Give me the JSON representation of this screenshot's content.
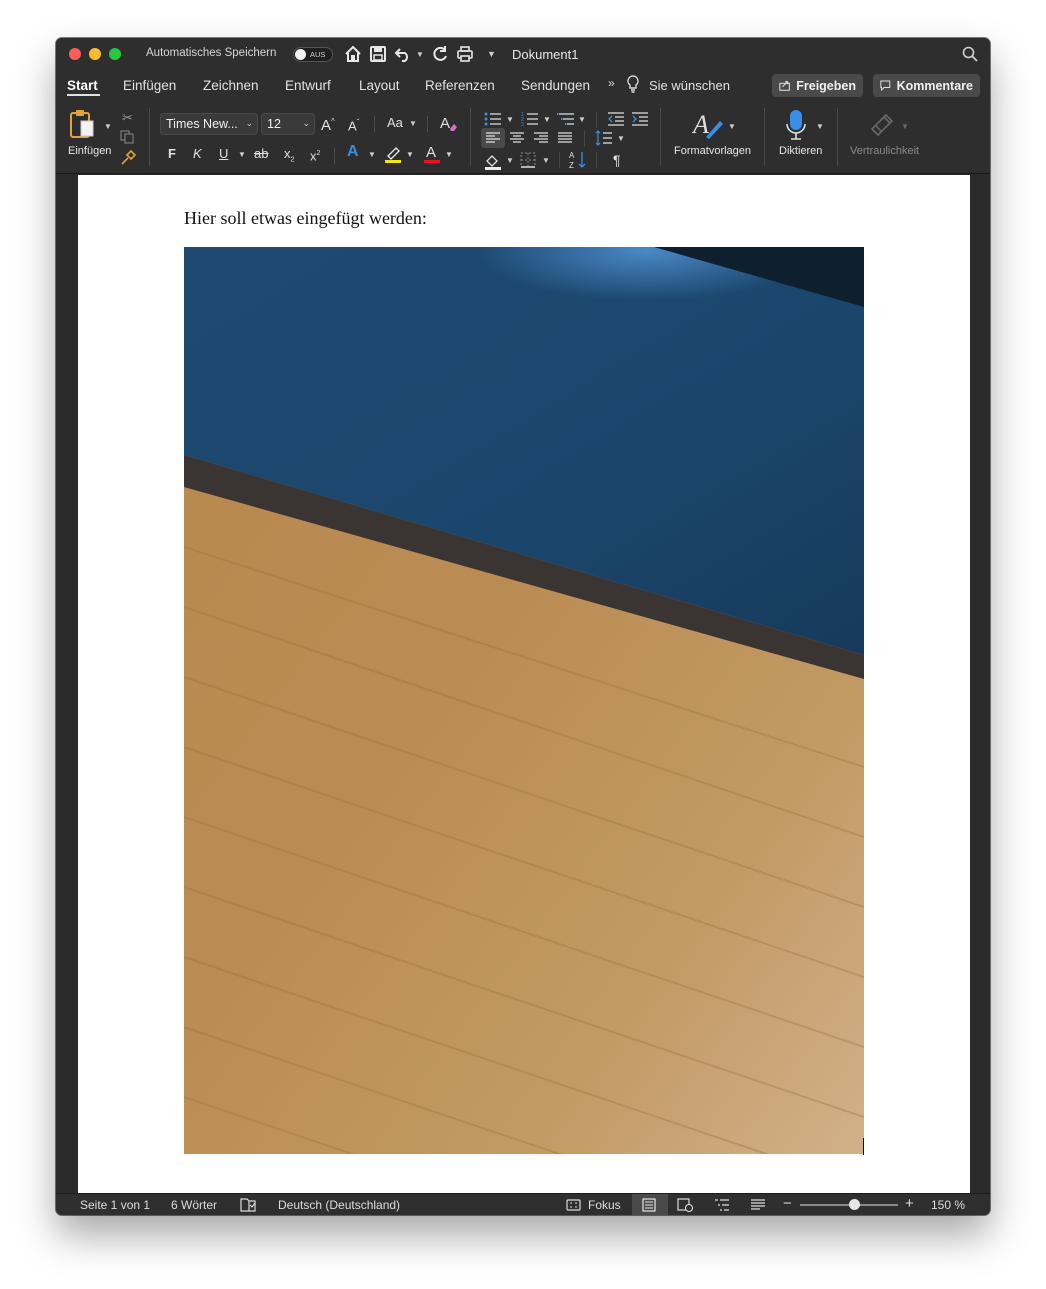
{
  "titlebar": {
    "autosave_label": "Automatisches Speichern",
    "autosave_state": "AUS",
    "document_title": "Dokument1"
  },
  "tabs": [
    {
      "label": "Start",
      "active": true
    },
    {
      "label": "Einfügen"
    },
    {
      "label": "Zeichnen"
    },
    {
      "label": "Entwurf"
    },
    {
      "label": "Layout"
    },
    {
      "label": "Referenzen"
    },
    {
      "label": "Sendungen"
    }
  ],
  "tell_me": "Sie wünschen",
  "share_button": "Freigeben",
  "comments_button": "Kommentare",
  "ribbon": {
    "paste_label": "Einfügen",
    "font_name": "Times New...",
    "font_size": "12",
    "case_label": "Aa",
    "bold": "F",
    "italic": "K",
    "underline": "U",
    "strike": "ab",
    "styles_label": "Formatvorlagen",
    "dictate_label": "Diktieren",
    "sensitivity_label": "Vertraulichkeit"
  },
  "document": {
    "text": "Hier soll etwas eingefügt werden:"
  },
  "statusbar": {
    "page_info": "Seite 1 von 1",
    "word_count": "6 Wörter",
    "language": "Deutsch (Deutschland)",
    "focus_label": "Fokus",
    "zoom": "150 %"
  },
  "colors": {
    "accent_blue": "#3a8ee6",
    "highlight_yellow": "#f5e60a",
    "font_color_red": "#e81123",
    "table_blue": "#1d4e7a",
    "wood": "#b88950"
  }
}
